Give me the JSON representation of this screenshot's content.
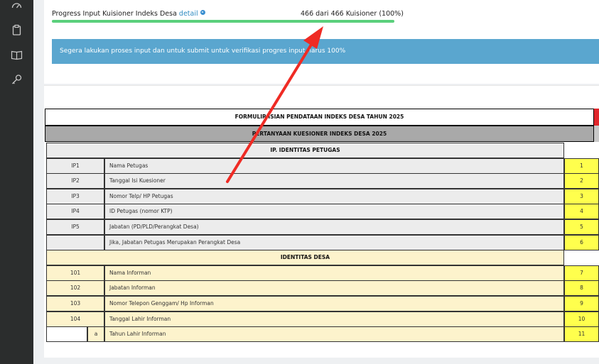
{
  "sidebar": {
    "icons": [
      "dashboard-icon",
      "clipboard-icon",
      "book-icon",
      "key-icon"
    ]
  },
  "progress": {
    "title": "Progress Input Kuisioner Indeks Desa",
    "detail_link": "detail",
    "count_text": "466 dari 466 Kuisioner (100%)",
    "fill_fraction": 1.0,
    "bar_color": "#5bd07c"
  },
  "alert": {
    "text": "Segera lakukan proses input dan untuk submit untuk verifikasi progres input harus 100%",
    "color": "#5aa6cf"
  },
  "form": {
    "title": "FORMULIR ISIAN PENDATAAN INDEKS DESA TAHUN 2025",
    "subtitle": "PERTANYAAN KUESIONER INDEKS DESA 2025",
    "sections": [
      {
        "title": "IP. IDENTITAS PETUGAS",
        "rows": [
          {
            "code": "IP1",
            "sub": "",
            "question": "Nama Petugas",
            "num": "1"
          },
          {
            "code": "IP2",
            "sub": "",
            "question": "Tanggal Isi Kuesioner",
            "num": "2"
          },
          {
            "code": "IP3",
            "sub": "",
            "question": "Nomor Telp/ HP Petugas",
            "num": "3"
          },
          {
            "code": "IP4",
            "sub": "",
            "question": "ID Petugas (nomor KTP)",
            "num": "4"
          },
          {
            "code": "IP5",
            "sub": "",
            "question": "Jabatan (PD/PLD/Perangkat Desa)",
            "num": "5"
          },
          {
            "code": "",
            "sub": "",
            "question": "Jika, Jabatan Petugas Merupakan Perangkat Desa",
            "num": "6"
          }
        ]
      },
      {
        "title": "IDENTITAS DESA",
        "rows": [
          {
            "code": "101",
            "sub": "",
            "question": "Nama Informan",
            "num": "7"
          },
          {
            "code": "102",
            "sub": "",
            "question": "Jabatan Informan",
            "num": "8"
          },
          {
            "code": "103",
            "sub": "",
            "question": "Nomor Telepon Genggam/ Hp Informan",
            "num": "9"
          },
          {
            "code": "104",
            "sub": "",
            "question": "Tanggal Lahir Informan",
            "num": "10"
          },
          {
            "code": "",
            "sub": "a",
            "question": "Tahun Lahir Informan",
            "num": "11"
          }
        ]
      }
    ]
  },
  "annotation": {
    "arrow_color": "#ef2b24"
  }
}
